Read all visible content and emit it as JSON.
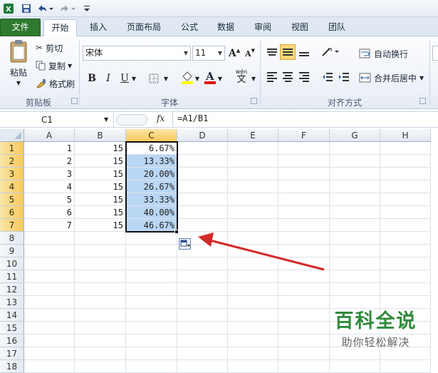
{
  "tabs": [
    "文件",
    "开始",
    "插入",
    "页面布局",
    "公式",
    "数据",
    "审阅",
    "视图",
    "团队"
  ],
  "clipboard": {
    "paste": "粘贴",
    "cut": "剪切",
    "copy": "复制",
    "format_painter": "格式刷",
    "group": "剪贴板"
  },
  "font": {
    "name": "宋体",
    "size": "11",
    "bold": "B",
    "italic": "I",
    "underline": "U",
    "phonetic": "wén",
    "phonetic_char": "文",
    "group": "字体",
    "grow": "A",
    "shrink": "A"
  },
  "alignment": {
    "wrap_text": "自动换行",
    "merge_center": "合并后居中",
    "group": "对齐方式"
  },
  "formula_bar": {
    "name_box": "C1",
    "fx": "fx",
    "formula": "=A1/B1"
  },
  "columns": [
    "A",
    "B",
    "C",
    "D",
    "E",
    "F",
    "G",
    "H"
  ],
  "rows": [
    "1",
    "2",
    "3",
    "4",
    "5",
    "6",
    "7",
    "8",
    "9",
    "10",
    "11",
    "12",
    "13",
    "14",
    "15",
    "16",
    "17",
    "18"
  ],
  "data": {
    "A": [
      "1",
      "2",
      "3",
      "4",
      "5",
      "6",
      "7"
    ],
    "B": [
      "15",
      "15",
      "15",
      "15",
      "15",
      "15",
      "15"
    ],
    "C": [
      "6.67%",
      "13.33%",
      "20.00%",
      "26.67%",
      "33.33%",
      "40.00%",
      "46.67%"
    ]
  },
  "watermark": {
    "title": "百科全说",
    "subtitle": "助你轻松解决"
  },
  "colors": {
    "file_tab": "#2f7a2f",
    "selection_fill": "#b9d6f3",
    "header_highlight": "#f7c95a",
    "arrow": "#d42a2a"
  }
}
